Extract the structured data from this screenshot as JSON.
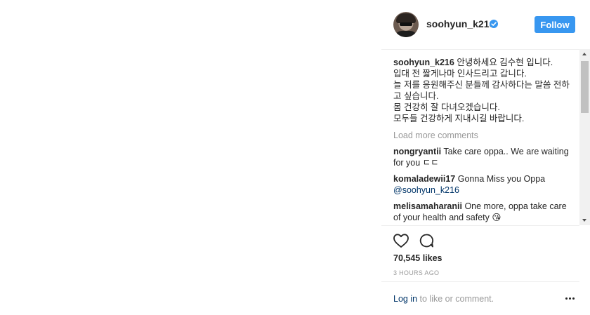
{
  "header": {
    "username": "soohyun_k216",
    "follow_label": "Follow"
  },
  "caption": {
    "username": "soohyun_k216",
    "lines": [
      "안녕하세요 김수현 입니다.",
      "입대 전 짧게나마 인사드리고 갑니다.",
      "늘 저를 응원해주신 분들께 감사하다는 말씀 전하고 싶습니다.",
      "몸 건강히 잘 다녀오겠습니다.",
      "모두들 건강하게 지내시길 바랍니다."
    ]
  },
  "load_more": "Load more comments",
  "comments": [
    {
      "username": "nongryantii",
      "text": "Take care oppa.. We are waiting for you ㄷㄷ"
    },
    {
      "username": "komaladewii17",
      "text": "Gonna Miss you Oppa",
      "mention": "@soohyun_k216"
    },
    {
      "username": "melisamaharanii",
      "text": "One more, oppa take care of your health and safety 😘"
    }
  ],
  "likes": "70,545 likes",
  "timestamp": "3 HOURS AGO",
  "login": {
    "link": "Log in",
    "rest": " to like or comment."
  },
  "icons": [
    "verified-icon",
    "heart-icon",
    "comment-icon",
    "more-icon"
  ],
  "colors": {
    "accent": "#3897f0",
    "link": "#003569",
    "muted": "#999999"
  }
}
